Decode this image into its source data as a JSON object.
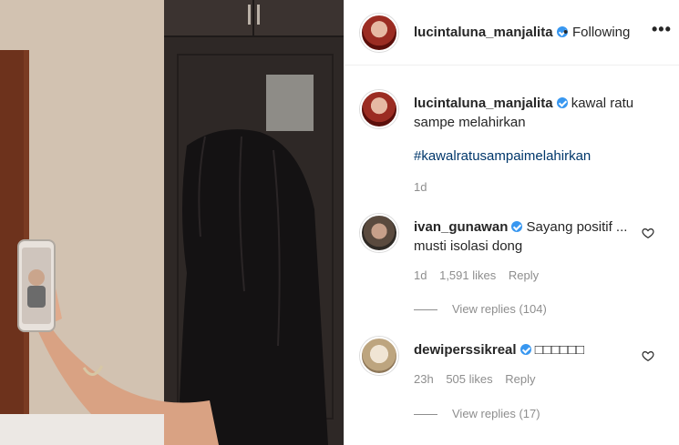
{
  "header": {
    "username": "lucintaluna_manjalita",
    "separator": "•",
    "follow_label": "Following",
    "more_icon": "more-horizontal-icon",
    "more_glyph": "•••"
  },
  "caption": {
    "username": "lucintaluna_manjalita",
    "text": "kawal ratu sampe melahirkan",
    "hashtag": "#kawalratusampaimelahirkan",
    "time": "1d"
  },
  "comments": [
    {
      "username": "ivan_gunawan",
      "text": "Sayang positif ... musti isolasi dong",
      "time": "1d",
      "likes": "1,591 likes",
      "reply_label": "Reply",
      "view_replies": "View replies (104)"
    },
    {
      "username": "dewiperssikreal",
      "text": "□□□□□□",
      "time": "23h",
      "likes": "505 likes",
      "reply_label": "Reply",
      "view_replies": "View replies (17)"
    }
  ],
  "colors": {
    "verified_blue": "#3897f0",
    "hashtag_blue": "#00376b",
    "muted_gray": "#8e8e8e",
    "text_dark": "#262626"
  }
}
